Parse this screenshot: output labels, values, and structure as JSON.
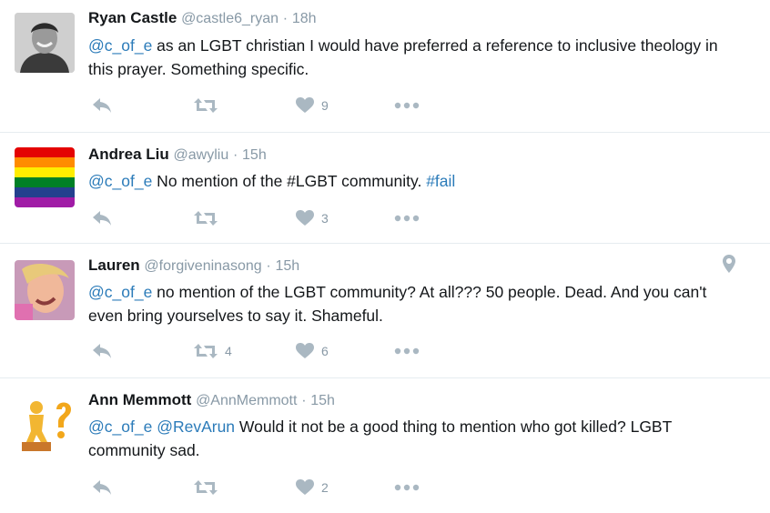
{
  "colors": {
    "text": "#14171a",
    "muted": "#8899a6",
    "link": "#2b7bb9",
    "icon": "#aab8c2",
    "divider": "#e6ecf0"
  },
  "tweets": [
    {
      "name": "Ryan Castle",
      "handle": "@castle6_ryan",
      "sep": "·",
      "time": "18h",
      "mention": "@c_of_e",
      "mention2": "",
      "text": " as an LGBT christian I would have preferred a reference to inclusive theology in this prayer. Something specific.",
      "hashtag": "",
      "retweets": "",
      "likes": "9",
      "avatar": "user-photo-avatar"
    },
    {
      "name": "Andrea Liu",
      "handle": "@awyliu",
      "sep": "·",
      "time": "15h",
      "mention": "@c_of_e",
      "mention2": "",
      "text": " No mention of the #LGBT community. ",
      "hashtag": "#fail",
      "retweets": "",
      "likes": "3",
      "avatar": "rainbow-flag-avatar"
    },
    {
      "name": "Lauren",
      "handle": "@forgiveninasong",
      "sep": "·",
      "time": "15h",
      "mention": "@c_of_e",
      "mention2": "",
      "text": " no mention of the LGBT community? At all??? 50 people. Dead. And you can't even bring yourselves to say it. Shameful.",
      "hashtag": "",
      "retweets": "4",
      "likes": "6",
      "avatar": "user-selfie-avatar",
      "location_icon": "location-pin-icon"
    },
    {
      "name": "Ann Memmott",
      "handle": "@AnnMemmott",
      "sep": "·",
      "time": "15h",
      "mention": "@c_of_e",
      "mention2": "@RevArun",
      "text": " Would it not be a good thing to mention who got killed? LGBT community sad.",
      "hashtag": "",
      "retweets": "",
      "likes": "2",
      "avatar": "thinker-question-avatar"
    }
  ]
}
